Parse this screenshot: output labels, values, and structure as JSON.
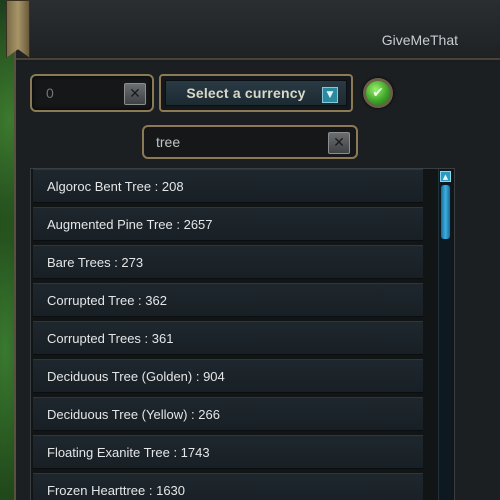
{
  "window": {
    "title": "GiveMeThat"
  },
  "amount": {
    "placeholder": "0",
    "value": ""
  },
  "clear_icon_glyph": "✕",
  "currency": {
    "label": "Select a currency",
    "arrow_glyph": "▼"
  },
  "confirm": {
    "glyph": "✔"
  },
  "search": {
    "value": "tree"
  },
  "results": [
    "Algoroc Bent Tree : 208",
    "Augmented Pine Tree : 2657",
    "Bare Trees : 273",
    "Corrupted Tree : 362",
    "Corrupted Trees : 361",
    "Deciduous Tree (Golden) : 904",
    "Deciduous Tree (Yellow) : 266",
    "Floating Exanite Tree : 1743",
    "Frozen Hearttree : 1630"
  ],
  "scroll_up_glyph": "▲",
  "colors": {
    "frame_gold": "#8c7a56",
    "accent_blue": "#2a9ac0",
    "confirm_green": "#3ea42a"
  }
}
